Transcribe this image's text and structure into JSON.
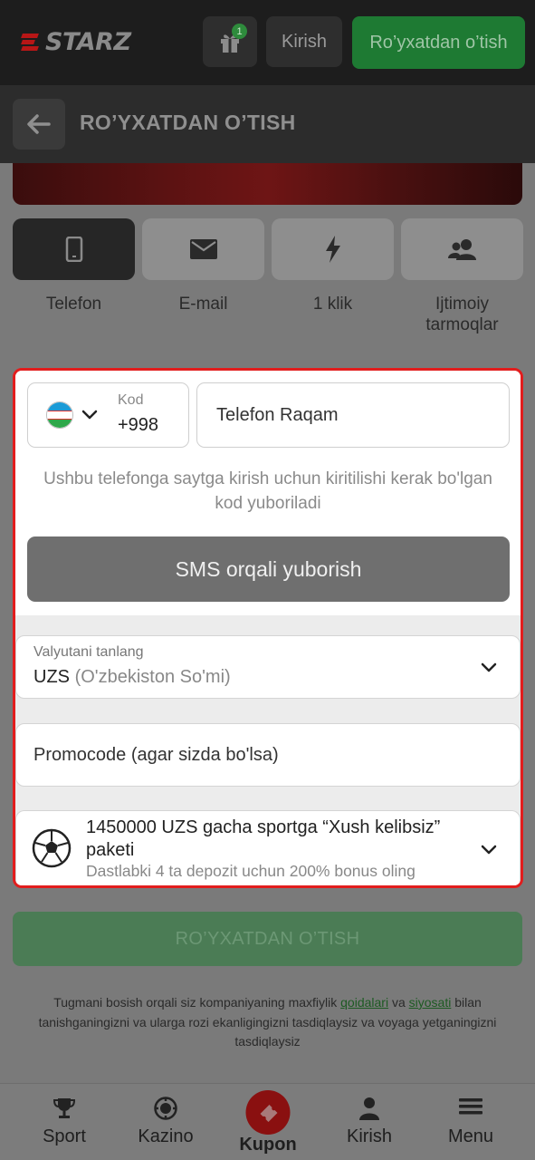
{
  "header": {
    "logo_text": "STARZ",
    "gift_badge": "1",
    "login_label": "Kirish",
    "register_label": "Ro’yxatdan o’tish"
  },
  "subheader": {
    "title": "RO’YXATDAN O’TISH"
  },
  "methods": [
    {
      "label": "Telefon",
      "icon": "phone-icon",
      "active": true
    },
    {
      "label": "E-mail",
      "icon": "envelope-icon",
      "active": false
    },
    {
      "label": "1 klik",
      "icon": "lightning-icon",
      "active": false
    },
    {
      "label": "Ijtimoiy tarmoqlar",
      "icon": "users-icon",
      "active": false
    }
  ],
  "phone": {
    "code_label": "Kod",
    "code_value": "+998",
    "country_flag": "uzbekistan-flag-icon",
    "number_placeholder": "Telefon Raqam",
    "hint": "Ushbu telefonga saytga kirish uchun kiritilishi kerak bo'lgan kod yuboriladi",
    "sms_button": "SMS orqali yuborish"
  },
  "currency": {
    "label": "Valyutani tanlang",
    "code": "UZS",
    "name": "(O'zbekiston So'mi)"
  },
  "promo": {
    "placeholder": "Promocode (agar sizda bo'lsa)"
  },
  "bonus": {
    "title": "1450000 UZS gacha sportga “Xush kelibsiz” paketi",
    "subtitle": "Dastlabki 4 ta depozit uchun 200% bonus oling"
  },
  "register_button": "RO’YXATDAN O’TISH",
  "terms": {
    "part1": "Tugmani bosish orqali siz kompaniyaning maxfiylik ",
    "link1": "qoidalari",
    "part2": " va ",
    "link2": "siyosati",
    "part3": " bilan tanishganingizni va ularga rozi ekanligingizni tasdiqlaysiz va voyaga yetganingizni tasdiqlaysiz"
  },
  "bottom_nav": [
    {
      "label": "Sport",
      "icon": "trophy-icon"
    },
    {
      "label": "Kazino",
      "icon": "casino-chip-icon"
    },
    {
      "label": "Kupon",
      "icon": "ticket-icon"
    },
    {
      "label": "Kirish",
      "icon": "user-icon"
    },
    {
      "label": "Menu",
      "icon": "hamburger-icon"
    }
  ],
  "colors": {
    "brand_green": "#1e7a33",
    "highlight_red": "#e21d1d",
    "coupon_red": "#8a1010"
  }
}
